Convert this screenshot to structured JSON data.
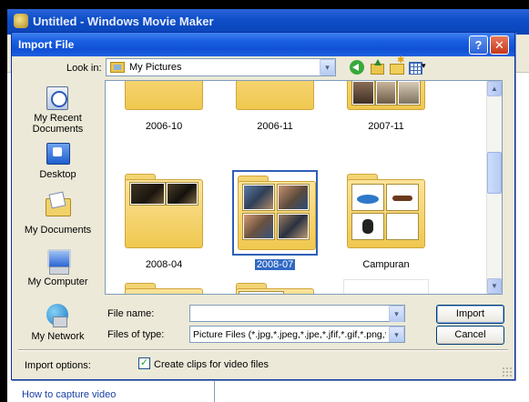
{
  "app": {
    "title": "Untitled - Windows Movie Maker",
    "task_link": "How to capture video"
  },
  "dialog": {
    "title": "Import File",
    "help_glyph": "?",
    "close_glyph": "✕",
    "look_in_label": "Look in:",
    "look_in_value": "My Pictures",
    "dropdown_glyph": "▾"
  },
  "places": [
    {
      "name": "recent",
      "label": "My Recent Documents",
      "icon": "recent-documents-icon"
    },
    {
      "name": "desktop",
      "label": "Desktop",
      "icon": "desktop-icon"
    },
    {
      "name": "mydocs",
      "label": "My Documents",
      "icon": "my-documents-icon"
    },
    {
      "name": "mycomputer",
      "label": "My Computer",
      "icon": "my-computer-icon"
    },
    {
      "name": "network",
      "label": "My Network",
      "icon": "my-network-icon"
    }
  ],
  "items": [
    {
      "label": "2006-10",
      "kind": "folder"
    },
    {
      "label": "2006-11",
      "kind": "folder"
    },
    {
      "label": "2007-11",
      "kind": "folder-photos"
    },
    {
      "label": "2008-04",
      "kind": "folder-photos"
    },
    {
      "label": "2008-07",
      "kind": "folder-photos",
      "selected": true
    },
    {
      "label": "Campuran",
      "kind": "folder-clipart"
    },
    {
      "label": "",
      "kind": "folder-photos"
    },
    {
      "label": "",
      "kind": "folder-screenshot"
    },
    {
      "label": "",
      "kind": "folder-plain"
    }
  ],
  "form": {
    "file_name_label": "File name:",
    "file_name_value": "",
    "file_type_label": "Files of type:",
    "file_type_value": "Picture Files (*.jpg,*.jpeg,*.jpe,*.jfif,*.gif,*.png,*.b",
    "import_button": "Import",
    "cancel_button": "Cancel",
    "import_options_label": "Import options:",
    "create_clips_label": "Create clips for video files",
    "create_clips_checked": true,
    "check_glyph": "✓"
  },
  "scrollbar": {
    "up_glyph": "▲",
    "down_glyph": "▼",
    "position": 0.4
  },
  "colors": {
    "titlebar": "#0f50d6",
    "selection": "#316ac5",
    "dialog_bg": "#ece9d8"
  }
}
